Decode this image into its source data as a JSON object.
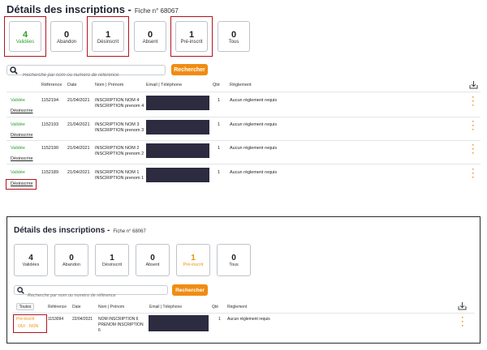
{
  "title": "Détails des inscriptions -",
  "fiche": "Fiche n° 68067",
  "panel1": {
    "cards": [
      {
        "count": "4",
        "label": "Validées"
      },
      {
        "count": "0",
        "label": "Abandon"
      },
      {
        "count": "1",
        "label": "Désinscrit"
      },
      {
        "count": "0",
        "label": "Absent"
      },
      {
        "count": "1",
        "label": "Pré-inscrit"
      },
      {
        "count": "0",
        "label": "Tous"
      }
    ],
    "search_placeholder": "Recherche par nom ou numéro de référence",
    "search_button": "Rechercher",
    "headers": {
      "reference": "Référence",
      "date": "Date",
      "name": "Nom | Prénom",
      "email": "Email | Téléphone",
      "qty": "Qté",
      "payment": "Règlement"
    },
    "rows": [
      {
        "status": "Validée",
        "action": "Désinscrire",
        "reference": "1152194",
        "date": "21/04/2021",
        "name1": "INSCRIPTION NOM 4",
        "name2": "INSCRIPTION prenom 4",
        "qty": "1",
        "payment": "Aucun règlement requis"
      },
      {
        "status": "Validée",
        "action": "Désinscrire",
        "reference": "1152193",
        "date": "21/04/2021",
        "name1": "INSCRIPTION NOM 3",
        "name2": "INSCRIPTION prenom 3",
        "qty": "1",
        "payment": "Aucun règlement requis"
      },
      {
        "status": "Validée",
        "action": "Désinscrire",
        "reference": "1152190",
        "date": "21/04/2021",
        "name1": "INSCRIPTION NOM 2",
        "name2": "INSCRIPTION prenom 2",
        "qty": "1",
        "payment": "Aucun règlement requis"
      },
      {
        "status": "Validée",
        "action": "Désinscrire",
        "reference": "1152189",
        "date": "21/04/2021",
        "name1": "INSCRIPTION NOM 1",
        "name2": "INSCRIPTION prenom 1",
        "qty": "1",
        "payment": "Aucun règlement requis"
      }
    ]
  },
  "panel2": {
    "cards": [
      {
        "count": "4",
        "label": "Validées"
      },
      {
        "count": "0",
        "label": "Abandon"
      },
      {
        "count": "1",
        "label": "Désinscrit"
      },
      {
        "count": "0",
        "label": "Absent"
      },
      {
        "count": "1",
        "label": "Pré-inscrit"
      },
      {
        "count": "0",
        "label": "Tous"
      }
    ],
    "search_placeholder": "Recherche par nom ou numéro de référence",
    "search_button": "Rechercher",
    "toutes": "Toutes",
    "headers": {
      "reference": "Référence",
      "date": "Date",
      "name": "Nom | Prénom",
      "email": "Email | Téléphone",
      "qty": "Qté",
      "payment": "Règlement"
    },
    "rows": [
      {
        "status": "Pré-inscrit",
        "action1": "OUI",
        "action2": "NON",
        "reference": "1153094",
        "date": "22/04/2021",
        "name1": "NOM INSCRIPTION 6",
        "name2": "PRENOM INSCRIPTION",
        "name3": "6",
        "qty": "1",
        "payment": "Aucun règlement requis"
      }
    ]
  },
  "colors": {
    "green": "#2ea12e",
    "orange": "#f08c12",
    "highlight": "#b0141f",
    "redaction": "#2c2b3f"
  },
  "icons": {
    "search": "magnifier-icon",
    "download": "download-icon",
    "menu": "kebab-menu-icon"
  }
}
